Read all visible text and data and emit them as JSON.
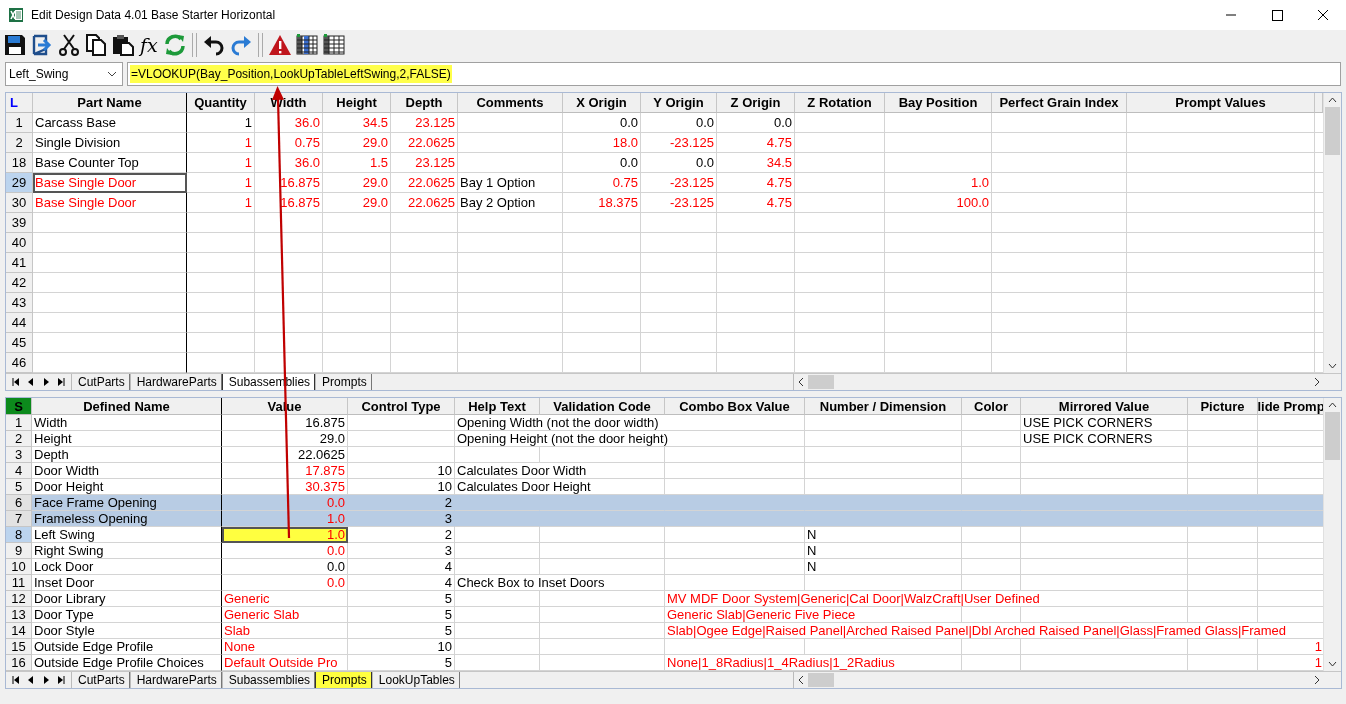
{
  "window": {
    "title": "Edit Design Data 4.01 Base Starter Horizontal"
  },
  "toolbar": [
    {
      "kind": "save"
    },
    {
      "kind": "export"
    },
    {
      "kind": "cut"
    },
    {
      "kind": "copy"
    },
    {
      "kind": "paste"
    },
    {
      "kind": "function",
      "label": "fx"
    },
    {
      "kind": "refresh"
    },
    {
      "kind": "separator"
    },
    {
      "kind": "undo"
    },
    {
      "kind": "redo"
    },
    {
      "kind": "separator"
    },
    {
      "kind": "warning"
    },
    {
      "kind": "gridcolumn"
    },
    {
      "kind": "grid"
    }
  ],
  "formula_bar": {
    "name_box": "Left_Swing",
    "formula": "=VLOOKUP(Bay_Position,LookUpTableLeftSwing,2,FALSE)",
    "highlighted": true
  },
  "sheets": [
    {
      "corner": {
        "label": "L",
        "selected": false
      },
      "columns": [
        "Part Name",
        "Quantity",
        "Width",
        "Height",
        "Depth",
        "Comments",
        "X Origin",
        "Y Origin",
        "Z Origin",
        "Z Rotation",
        "Bay Position",
        "Perfect Grain Index",
        "Prompt Values"
      ],
      "rows": [
        {
          "num": "1",
          "selected": false,
          "active": false,
          "cells": [
            {
              "text": "Carcass Base",
              "red": false,
              "active": false,
              "highlighted": false
            },
            {
              "text": "1",
              "red": false,
              "active": false,
              "highlighted": false
            },
            {
              "text": "36.0",
              "red": true,
              "active": false,
              "highlighted": false
            },
            {
              "text": "34.5",
              "red": true,
              "active": false,
              "highlighted": false
            },
            {
              "text": "23.125",
              "red": true,
              "active": false,
              "highlighted": false
            },
            null,
            {
              "text": "0.0",
              "red": false,
              "active": false,
              "highlighted": false
            },
            {
              "text": "0.0",
              "red": false,
              "active": false,
              "highlighted": false
            },
            {
              "text": "0.0",
              "red": false,
              "active": false,
              "highlighted": false
            }
          ]
        },
        {
          "num": "2",
          "selected": false,
          "active": false,
          "cells": [
            {
              "text": "Single Division",
              "red": false,
              "active": false,
              "highlighted": false
            },
            {
              "text": "1",
              "red": true,
              "active": false,
              "highlighted": false
            },
            {
              "text": "0.75",
              "red": true,
              "active": false,
              "highlighted": false
            },
            {
              "text": "29.0",
              "red": true,
              "active": false,
              "highlighted": false
            },
            {
              "text": "22.0625",
              "red": true,
              "active": false,
              "highlighted": false
            },
            null,
            {
              "text": "18.0",
              "red": true,
              "active": false,
              "highlighted": false
            },
            {
              "text": "-23.125",
              "red": true,
              "active": false,
              "highlighted": false
            },
            {
              "text": "4.75",
              "red": true,
              "active": false,
              "highlighted": false
            }
          ]
        },
        {
          "num": "18",
          "selected": false,
          "active": false,
          "cells": [
            {
              "text": "Base Counter Top",
              "red": false,
              "active": false,
              "highlighted": false
            },
            {
              "text": "1",
              "red": true,
              "active": false,
              "highlighted": false
            },
            {
              "text": "36.0",
              "red": true,
              "active": false,
              "highlighted": false
            },
            {
              "text": "1.5",
              "red": true,
              "active": false,
              "highlighted": false
            },
            {
              "text": "23.125",
              "red": true,
              "active": false,
              "highlighted": false
            },
            null,
            {
              "text": "0.0",
              "red": false,
              "active": false,
              "highlighted": false
            },
            {
              "text": "0.0",
              "red": false,
              "active": false,
              "highlighted": false
            },
            {
              "text": "34.5",
              "red": true,
              "active": false,
              "highlighted": false
            }
          ]
        },
        {
          "num": "29",
          "selected": false,
          "active": true,
          "cells": [
            {
              "text": "Base Single Door",
              "red": true,
              "active": true,
              "highlighted": false
            },
            {
              "text": "1",
              "red": true,
              "active": false,
              "highlighted": false
            },
            {
              "text": "16.875",
              "red": true,
              "active": false,
              "highlighted": false
            },
            {
              "text": "29.0",
              "red": true,
              "active": false,
              "highlighted": false
            },
            {
              "text": "22.0625",
              "red": true,
              "active": false,
              "highlighted": false
            },
            {
              "text": "Bay 1 Option",
              "red": false,
              "active": false,
              "highlighted": false
            },
            {
              "text": "0.75",
              "red": true,
              "active": false,
              "highlighted": false
            },
            {
              "text": "-23.125",
              "red": true,
              "active": false,
              "highlighted": false
            },
            {
              "text": "4.75",
              "red": true,
              "active": false,
              "highlighted": false
            },
            null,
            {
              "text": "1.0",
              "red": true,
              "active": false,
              "highlighted": false
            }
          ]
        },
        {
          "num": "30",
          "selected": false,
          "active": false,
          "cells": [
            {
              "text": "Base Single Door",
              "red": true,
              "active": false,
              "highlighted": false
            },
            {
              "text": "1",
              "red": true,
              "active": false,
              "highlighted": false
            },
            {
              "text": "16.875",
              "red": true,
              "active": false,
              "highlighted": false
            },
            {
              "text": "29.0",
              "red": true,
              "active": false,
              "highlighted": false
            },
            {
              "text": "22.0625",
              "red": true,
              "active": false,
              "highlighted": false
            },
            {
              "text": "Bay 2 Option",
              "red": false,
              "active": false,
              "highlighted": false
            },
            {
              "text": "18.375",
              "red": true,
              "active": false,
              "highlighted": false
            },
            {
              "text": "-23.125",
              "red": true,
              "active": false,
              "highlighted": false
            },
            {
              "text": "4.75",
              "red": true,
              "active": false,
              "highlighted": false
            },
            null,
            {
              "text": "100.0",
              "red": true,
              "active": false,
              "highlighted": false
            }
          ]
        },
        {
          "num": "39",
          "selected": false,
          "active": false
        },
        {
          "num": "40",
          "selected": false,
          "active": false
        },
        {
          "num": "41",
          "selected": false,
          "active": false
        },
        {
          "num": "42",
          "selected": false,
          "active": false
        },
        {
          "num": "43",
          "selected": false,
          "active": false
        },
        {
          "num": "44",
          "selected": false,
          "active": false
        },
        {
          "num": "45",
          "selected": false,
          "active": false
        },
        {
          "num": "46",
          "selected": false,
          "active": false
        }
      ],
      "tabs": [
        {
          "label": "CutParts",
          "selected": false,
          "highlighted": false
        },
        {
          "label": "HardwareParts",
          "selected": false,
          "highlighted": false
        },
        {
          "label": "Subassemblies",
          "selected": true,
          "highlighted": false
        },
        {
          "label": "Prompts",
          "selected": false,
          "highlighted": false
        }
      ]
    },
    {
      "corner": {
        "label": "S",
        "selected": true
      },
      "columns": [
        "Defined Name",
        "Value",
        "Control Type",
        "Help Text",
        "Validation Code",
        "Combo Box Value",
        "Number / Dimension",
        "Color",
        "Mirrored Value",
        "Picture",
        "lide Promp"
      ],
      "rows": [
        {
          "num": "1",
          "selected": false,
          "active": false,
          "cells": [
            {
              "text": "Width",
              "red": false,
              "active": false,
              "highlighted": false
            },
            {
              "text": "16.875",
              "red": false,
              "active": false,
              "highlighted": false
            },
            null,
            {
              "text": "Opening Width (not the door width)",
              "red": false,
              "active": false,
              "highlighted": false
            },
            null,
            null,
            null,
            null,
            {
              "text": "USE PICK CORNERS",
              "red": false,
              "active": false,
              "highlighted": false
            }
          ]
        },
        {
          "num": "2",
          "selected": false,
          "active": false,
          "cells": [
            {
              "text": "Height",
              "red": false,
              "active": false,
              "highlighted": false
            },
            {
              "text": "29.0",
              "red": false,
              "active": false,
              "highlighted": false
            },
            null,
            {
              "text": "Opening Height (not the door height)",
              "red": false,
              "active": false,
              "highlighted": false
            },
            null,
            null,
            null,
            null,
            {
              "text": "USE PICK CORNERS",
              "red": false,
              "active": false,
              "highlighted": false
            }
          ]
        },
        {
          "num": "3",
          "selected": false,
          "active": false,
          "cells": [
            {
              "text": "Depth",
              "red": false,
              "active": false,
              "highlighted": false
            },
            {
              "text": "22.0625",
              "red": false,
              "active": false,
              "highlighted": false
            }
          ]
        },
        {
          "num": "4",
          "selected": false,
          "active": false,
          "cells": [
            {
              "text": "Door Width",
              "red": false,
              "active": false,
              "highlighted": false
            },
            {
              "text": "17.875",
              "red": true,
              "active": false,
              "highlighted": false
            },
            {
              "text": "10",
              "red": false,
              "active": false,
              "highlighted": false
            },
            {
              "text": "Calculates Door Width",
              "red": false,
              "active": false,
              "highlighted": false
            }
          ]
        },
        {
          "num": "5",
          "selected": false,
          "active": false,
          "cells": [
            {
              "text": "Door Height",
              "red": false,
              "active": false,
              "highlighted": false
            },
            {
              "text": "30.375",
              "red": true,
              "active": false,
              "highlighted": false
            },
            {
              "text": "10",
              "red": false,
              "active": false,
              "highlighted": false
            },
            {
              "text": "Calculates Door Height",
              "red": false,
              "active": false,
              "highlighted": false
            }
          ]
        },
        {
          "num": "6",
          "selected": true,
          "active": false,
          "cells": [
            {
              "text": "Face Frame Opening",
              "red": false,
              "active": false,
              "highlighted": false
            },
            {
              "text": "0.0",
              "red": true,
              "active": false,
              "highlighted": false
            },
            {
              "text": "2",
              "red": false,
              "active": false,
              "highlighted": false
            }
          ]
        },
        {
          "num": "7",
          "selected": true,
          "active": false,
          "cells": [
            {
              "text": "Frameless Opening",
              "red": false,
              "active": false,
              "highlighted": false
            },
            {
              "text": "1.0",
              "red": true,
              "active": false,
              "highlighted": false
            },
            {
              "text": "3",
              "red": false,
              "active": false,
              "highlighted": false
            }
          ]
        },
        {
          "num": "8",
          "selected": false,
          "active": true,
          "cells": [
            {
              "text": "Left Swing",
              "red": false,
              "active": false,
              "highlighted": false
            },
            {
              "text": "1.0",
              "red": true,
              "active": true,
              "highlighted": true
            },
            {
              "text": "2",
              "red": false,
              "active": false,
              "highlighted": false
            },
            null,
            null,
            null,
            {
              "text": "N",
              "red": false,
              "active": false,
              "highlighted": false
            }
          ]
        },
        {
          "num": "9",
          "selected": false,
          "active": false,
          "cells": [
            {
              "text": "Right Swing",
              "red": false,
              "active": false,
              "highlighted": false
            },
            {
              "text": "0.0",
              "red": true,
              "active": false,
              "highlighted": false
            },
            {
              "text": "3",
              "red": false,
              "active": false,
              "highlighted": false
            },
            null,
            null,
            null,
            {
              "text": "N",
              "red": false,
              "active": false,
              "highlighted": false
            }
          ]
        },
        {
          "num": "10",
          "selected": false,
          "active": false,
          "cells": [
            {
              "text": "Lock Door",
              "red": false,
              "active": false,
              "highlighted": false
            },
            {
              "text": "0.0",
              "red": false,
              "active": false,
              "highlighted": false
            },
            {
              "text": "4",
              "red": false,
              "active": false,
              "highlighted": false
            },
            null,
            null,
            null,
            {
              "text": "N",
              "red": false,
              "active": false,
              "highlighted": false
            }
          ]
        },
        {
          "num": "11",
          "selected": false,
          "active": false,
          "cells": [
            {
              "text": "Inset Door",
              "red": false,
              "active": false,
              "highlighted": false
            },
            {
              "text": "0.0",
              "red": true,
              "active": false,
              "highlighted": false
            },
            {
              "text": "4",
              "red": false,
              "active": false,
              "highlighted": false
            },
            {
              "text": "Check Box to Inset Doors",
              "red": false,
              "active": false,
              "highlighted": false
            }
          ]
        },
        {
          "num": "12",
          "selected": false,
          "active": false,
          "cells": [
            {
              "text": "Door Library",
              "red": false,
              "active": false,
              "highlighted": false
            },
            {
              "text": "Generic",
              "red": true,
              "active": false,
              "highlighted": false
            },
            {
              "text": "5",
              "red": false,
              "active": false,
              "highlighted": false
            },
            null,
            null,
            {
              "text": "MV MDF Door System|Generic|Cal Door|WalzCraft|User Defined",
              "red": true,
              "active": false,
              "highlighted": false
            }
          ]
        },
        {
          "num": "13",
          "selected": false,
          "active": false,
          "cells": [
            {
              "text": "Door Type",
              "red": false,
              "active": false,
              "highlighted": false
            },
            {
              "text": "Generic Slab",
              "red": true,
              "active": false,
              "highlighted": false
            },
            {
              "text": "5",
              "red": false,
              "active": false,
              "highlighted": false
            },
            null,
            null,
            {
              "text": "Generic Slab|Generic Five Piece",
              "red": true,
              "active": false,
              "highlighted": false
            }
          ]
        },
        {
          "num": "14",
          "selected": false,
          "active": false,
          "cells": [
            {
              "text": "Door Style",
              "red": false,
              "active": false,
              "highlighted": false
            },
            {
              "text": "Slab",
              "red": true,
              "active": false,
              "highlighted": false
            },
            {
              "text": "5",
              "red": false,
              "active": false,
              "highlighted": false
            },
            null,
            null,
            {
              "text": "Slab|Ogee Edge|Raised Panel|Arched Raised Panel|Dbl Arched Raised Panel|Glass|Framed Glass|Framed",
              "red": true,
              "active": false,
              "highlighted": false
            }
          ]
        },
        {
          "num": "15",
          "selected": false,
          "active": false,
          "cells": [
            {
              "text": "Outside Edge Profile",
              "red": false,
              "active": false,
              "highlighted": false
            },
            {
              "text": "None",
              "red": true,
              "active": false,
              "highlighted": false
            },
            {
              "text": "10",
              "red": false,
              "active": false,
              "highlighted": false
            },
            null,
            null,
            null,
            null,
            null,
            null,
            null,
            {
              "text": "1",
              "red": true,
              "active": false,
              "highlighted": false
            }
          ]
        },
        {
          "num": "16",
          "selected": false,
          "active": false,
          "cells": [
            {
              "text": "Outside Edge Profile Choices",
              "red": false,
              "active": false,
              "highlighted": false
            },
            {
              "text": "Default Outside Pro",
              "red": true,
              "active": false,
              "highlighted": false
            },
            {
              "text": "5",
              "red": false,
              "active": false,
              "highlighted": false
            },
            null,
            null,
            {
              "text": "None|1_8Radius|1_4Radius|1_2Radius",
              "red": true,
              "active": false,
              "highlighted": false
            },
            null,
            null,
            null,
            null,
            {
              "text": "1",
              "red": true,
              "active": false,
              "highlighted": false
            }
          ]
        }
      ],
      "tabs": [
        {
          "label": "CutParts",
          "selected": false,
          "highlighted": false
        },
        {
          "label": "HardwareParts",
          "selected": false,
          "highlighted": false
        },
        {
          "label": "Subassemblies",
          "selected": false,
          "highlighted": false
        },
        {
          "label": "Prompts",
          "selected": true,
          "highlighted": true
        },
        {
          "label": "LookUpTables",
          "selected": false,
          "highlighted": false
        }
      ]
    }
  ]
}
